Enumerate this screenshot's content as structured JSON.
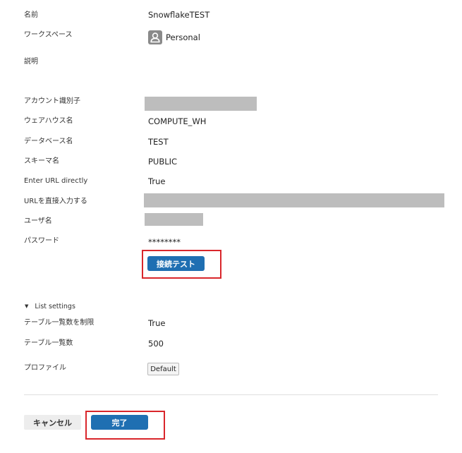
{
  "form": {
    "name": {
      "label": "名前",
      "value": "SnowflakeTEST"
    },
    "workspace": {
      "label": "ワークスペース",
      "value": "Personal",
      "icon": "user-icon"
    },
    "description": {
      "label": "説明",
      "value": ""
    },
    "account_id": {
      "label": "アカウント識別子"
    },
    "warehouse": {
      "label": "ウェアハウス名",
      "value": "COMPUTE_WH"
    },
    "database": {
      "label": "データベース名",
      "value": "TEST"
    },
    "schema": {
      "label": "スキーマ名",
      "value": "PUBLIC"
    },
    "enter_url_directly": {
      "label": "Enter URL directly",
      "value": "True"
    },
    "url_direct": {
      "label": "URLを直接入力する"
    },
    "username": {
      "label": "ユーザ名"
    },
    "password": {
      "label": "パスワード",
      "value": "********"
    },
    "test_connection_label": "接続テスト"
  },
  "list_settings": {
    "toggle_label": "List settings",
    "limit_tables": {
      "label": "テーブル一覧数を制限",
      "value": "True"
    },
    "table_count": {
      "label": "テーブル一覧数",
      "value": "500"
    },
    "profile": {
      "label": "プロファイル",
      "button_label": "Default"
    }
  },
  "footer": {
    "cancel_label": "キャンセル",
    "done_label": "完了"
  },
  "colors": {
    "primary": "#1f6fb2",
    "highlight": "#d9262b",
    "masked": "#bdbdbd"
  }
}
